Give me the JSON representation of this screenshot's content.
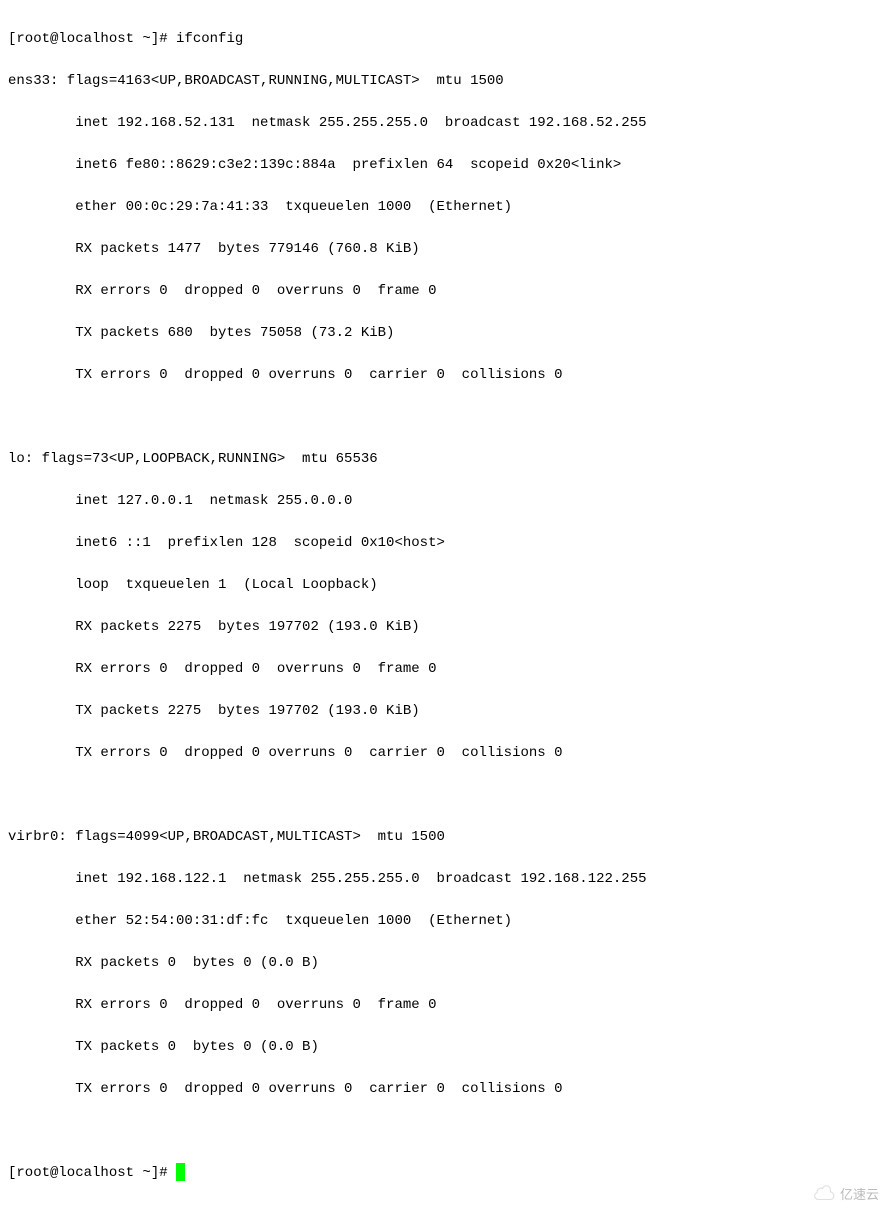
{
  "prompt1": "[root@localhost ~]# ",
  "command": "ifconfig",
  "interfaces": {
    "ens33": {
      "header": "ens33: flags=4163<UP,BROADCAST,RUNNING,MULTICAST>  mtu 1500",
      "inet": "        inet 192.168.52.131  netmask 255.255.255.0  broadcast 192.168.52.255",
      "inet6": "        inet6 fe80::8629:c3e2:139c:884a  prefixlen 64  scopeid 0x20<link>",
      "ether": "        ether 00:0c:29:7a:41:33  txqueuelen 1000  (Ethernet)",
      "rx_packets": "        RX packets 1477  bytes 779146 (760.8 KiB)",
      "rx_errors": "        RX errors 0  dropped 0  overruns 0  frame 0",
      "tx_packets": "        TX packets 680  bytes 75058 (73.2 KiB)",
      "tx_errors": "        TX errors 0  dropped 0 overruns 0  carrier 0  collisions 0"
    },
    "lo": {
      "header": "lo: flags=73<UP,LOOPBACK,RUNNING>  mtu 65536",
      "inet": "        inet 127.0.0.1  netmask 255.0.0.0",
      "inet6": "        inet6 ::1  prefixlen 128  scopeid 0x10<host>",
      "loop": "        loop  txqueuelen 1  (Local Loopback)",
      "rx_packets": "        RX packets 2275  bytes 197702 (193.0 KiB)",
      "rx_errors": "        RX errors 0  dropped 0  overruns 0  frame 0",
      "tx_packets": "        TX packets 2275  bytes 197702 (193.0 KiB)",
      "tx_errors": "        TX errors 0  dropped 0 overruns 0  carrier 0  collisions 0"
    },
    "virbr0": {
      "header": "virbr0: flags=4099<UP,BROADCAST,MULTICAST>  mtu 1500",
      "inet": "        inet 192.168.122.1  netmask 255.255.255.0  broadcast 192.168.122.255",
      "ether": "        ether 52:54:00:31:df:fc  txqueuelen 1000  (Ethernet)",
      "rx_packets": "        RX packets 0  bytes 0 (0.0 B)",
      "rx_errors": "        RX errors 0  dropped 0  overruns 0  frame 0",
      "tx_packets": "        TX packets 0  bytes 0 (0.0 B)",
      "tx_errors": "        TX errors 0  dropped 0 overruns 0  carrier 0  collisions 0"
    }
  },
  "prompt2": "[root@localhost ~]# ",
  "watermark": "亿速云"
}
